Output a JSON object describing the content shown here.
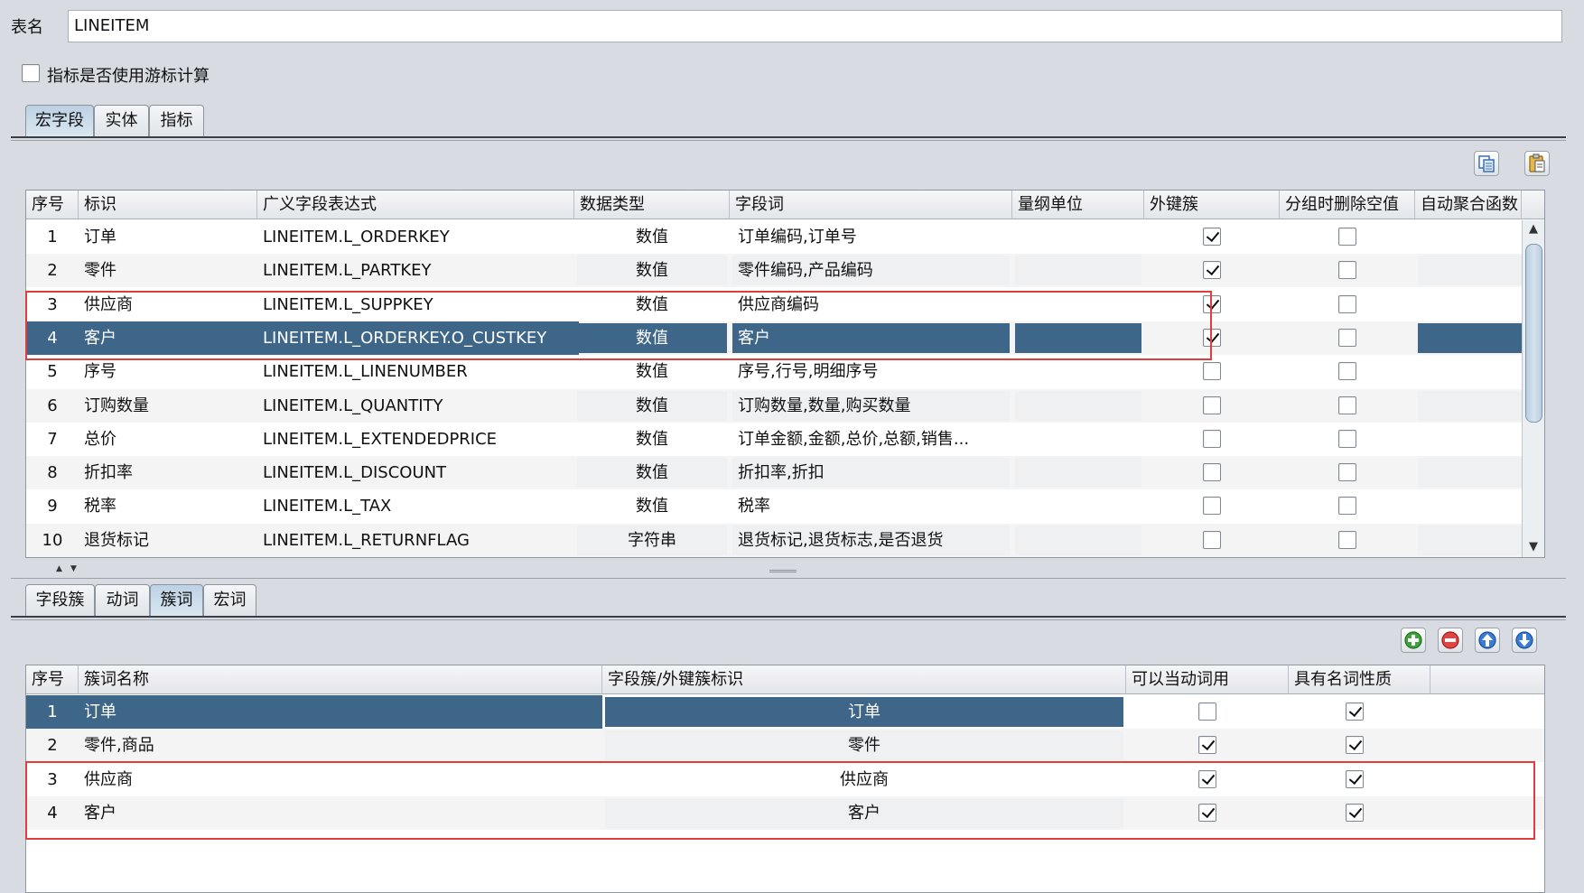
{
  "table_name": {
    "label": "表名",
    "value": "LINEITEM"
  },
  "cursor_option": {
    "label": "指标是否使用游标计算",
    "checked": false
  },
  "top_tabs": [
    "宏字段",
    "实体",
    "指标"
  ],
  "top_active_tab": 0,
  "top_table": {
    "headers": [
      "序号",
      "标识",
      "广义字段表达式",
      "数据类型",
      "字段词",
      "量纲单位",
      "外键簇",
      "分组时删除空值",
      "自动聚合函数"
    ],
    "rows": [
      {
        "no": "1",
        "id": "订单",
        "expr": "LINEITEM.L_ORDERKEY",
        "type": "数值",
        "words": "订单编码,订单号",
        "unit": "",
        "fk": true,
        "del_null": false,
        "agg": ""
      },
      {
        "no": "2",
        "id": "零件",
        "expr": "LINEITEM.L_PARTKEY",
        "type": "数值",
        "words": "零件编码,产品编码",
        "unit": "",
        "fk": true,
        "del_null": false,
        "agg": ""
      },
      {
        "no": "3",
        "id": "供应商",
        "expr": "LINEITEM.L_SUPPKEY",
        "type": "数值",
        "words": "供应商编码",
        "unit": "",
        "fk": true,
        "del_null": false,
        "agg": ""
      },
      {
        "no": "4",
        "id": "客户",
        "expr": "LINEITEM.L_ORDERKEY.O_CUSTKEY",
        "type": "数值",
        "words": "客户",
        "unit": "",
        "fk": true,
        "del_null": false,
        "agg": ""
      },
      {
        "no": "5",
        "id": "序号",
        "expr": "LINEITEM.L_LINENUMBER",
        "type": "数值",
        "words": "序号,行号,明细序号",
        "unit": "",
        "fk": false,
        "del_null": false,
        "agg": ""
      },
      {
        "no": "6",
        "id": "订购数量",
        "expr": "LINEITEM.L_QUANTITY",
        "type": "数值",
        "words": "订购数量,数量,购买数量",
        "unit": "",
        "fk": false,
        "del_null": false,
        "agg": ""
      },
      {
        "no": "7",
        "id": "总价",
        "expr": "LINEITEM.L_EXTENDEDPRICE",
        "type": "数值",
        "words": "订单金额,金额,总价,总额,销售...",
        "unit": "",
        "fk": false,
        "del_null": false,
        "agg": ""
      },
      {
        "no": "8",
        "id": "折扣率",
        "expr": "LINEITEM.L_DISCOUNT",
        "type": "数值",
        "words": "折扣率,折扣",
        "unit": "",
        "fk": false,
        "del_null": false,
        "agg": ""
      },
      {
        "no": "9",
        "id": "税率",
        "expr": "LINEITEM.L_TAX",
        "type": "数值",
        "words": "税率",
        "unit": "",
        "fk": false,
        "del_null": false,
        "agg": ""
      },
      {
        "no": "10",
        "id": "退货标记",
        "expr": "LINEITEM.L_RETURNFLAG",
        "type": "字符串",
        "words": "退货标记,退货标志,是否退货",
        "unit": "",
        "fk": false,
        "del_null": false,
        "agg": ""
      }
    ],
    "selected_row": 3
  },
  "bottom_tabs": [
    "字段簇",
    "动词",
    "簇词",
    "宏词"
  ],
  "bottom_active_tab": 2,
  "bottom_table": {
    "headers": [
      "序号",
      "簇词名称",
      "字段簇/外键簇标识",
      "可以当动词用",
      "具有名词性质"
    ],
    "rows": [
      {
        "no": "1",
        "name": "订单",
        "ident": "订单",
        "as_verb": false,
        "noun": true
      },
      {
        "no": "2",
        "name": "零件,商品",
        "ident": "零件",
        "as_verb": true,
        "noun": true
      },
      {
        "no": "3",
        "name": "供应商",
        "ident": "供应商",
        "as_verb": true,
        "noun": true
      },
      {
        "no": "4",
        "name": "客户",
        "ident": "客户",
        "as_verb": true,
        "noun": true
      }
    ],
    "selected_row": 0
  },
  "icons": {
    "copy": "copy-icon",
    "paste": "paste-icon",
    "add": "add-icon",
    "remove": "remove-icon",
    "move_up": "arrow-up-icon",
    "move_down": "arrow-down-icon"
  },
  "colors": {
    "selection": "#3e6689",
    "highlight_box": "#e03d3d",
    "background": "#d8dce2"
  }
}
